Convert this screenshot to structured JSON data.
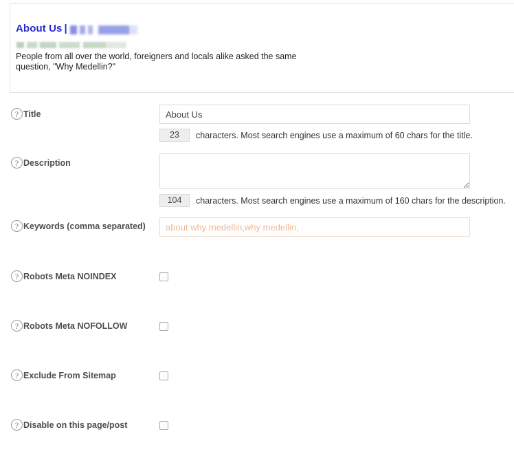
{
  "preview": {
    "title_text": "About Us",
    "title_separator": "|",
    "redacted_sitename": "",
    "redacted_url": "",
    "description": "People from all over the world, foreigners and locals alike asked the same question, \"Why Medellin?\"",
    "title_color": "#2a2ad0"
  },
  "form": {
    "rows": [
      {
        "label": "Title",
        "help_icon": "question-mark-icon",
        "type": "text",
        "value": "About Us",
        "placeholder": "",
        "counter": "23",
        "hint": "characters. Most search engines use a maximum of 60 chars for the title."
      },
      {
        "label": "Description",
        "help_icon": "question-mark-icon",
        "type": "textarea",
        "value": "",
        "placeholder": "",
        "counter": "104",
        "hint": "characters. Most search engines use a maximum of 160 chars for the description."
      },
      {
        "label": "Keywords (comma separated)",
        "help_icon": "question-mark-icon",
        "type": "text",
        "value": "",
        "placeholder": "about why medellin,why medellin,",
        "counter": "",
        "hint": ""
      },
      {
        "label": "Robots Meta NOINDEX",
        "help_icon": "question-mark-icon",
        "type": "checkbox",
        "checked": false
      },
      {
        "label": "Robots Meta NOFOLLOW",
        "help_icon": "question-mark-icon",
        "type": "checkbox",
        "checked": false
      },
      {
        "label": "Exclude From Sitemap",
        "help_icon": "question-mark-icon",
        "type": "checkbox",
        "checked": false
      },
      {
        "label": "Disable on this page/post",
        "help_icon": "question-mark-icon",
        "type": "checkbox",
        "checked": false
      }
    ]
  },
  "icons": {
    "help": "?"
  }
}
